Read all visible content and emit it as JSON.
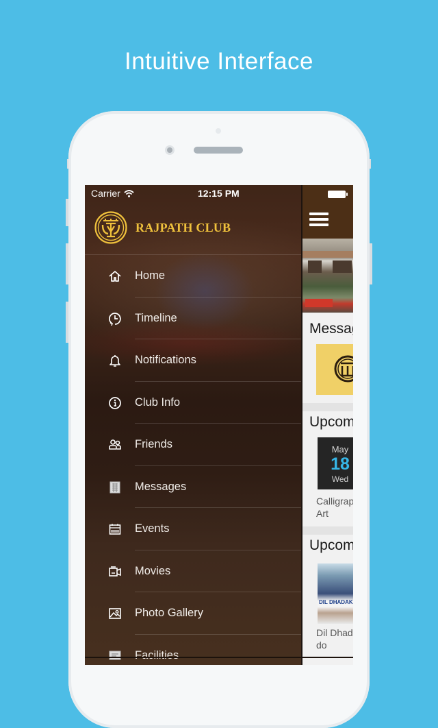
{
  "headline": "Intuitive Interface",
  "status_bar": {
    "carrier": "Carrier",
    "time": "12:15 PM",
    "icons": [
      "wifi-icon",
      "battery-icon"
    ]
  },
  "drawer": {
    "brand_name": "RAJPATH CLUB",
    "logo": "rajpath-club-logo",
    "menu": [
      {
        "label": "Home",
        "icon": "home-icon"
      },
      {
        "label": "Timeline",
        "icon": "clock-history-icon"
      },
      {
        "label": "Notifications",
        "icon": "bell-icon"
      },
      {
        "label": "Club Info",
        "icon": "info-circle-icon"
      },
      {
        "label": "Friends",
        "icon": "friends-icon"
      },
      {
        "label": "Messages",
        "icon": "messages-icon"
      },
      {
        "label": "Events",
        "icon": "calendar-icon"
      },
      {
        "label": "Movies",
        "icon": "video-camera-icon"
      },
      {
        "label": "Photo Gallery",
        "icon": "photo-icon"
      },
      {
        "label": "Facilities",
        "icon": "facilities-icon"
      }
    ]
  },
  "app": {
    "menu_button": "hamburger-menu-icon",
    "sections": [
      {
        "title": "Messages"
      },
      {
        "title": "Upcoming Events",
        "card": {
          "month": "May",
          "day": "18",
          "weekday": "Wed",
          "title_line1": "Calligraphy",
          "title_line2": "Art"
        }
      },
      {
        "title": "Upcoming Movies",
        "card": {
          "poster_text": "DIL DHADAKNE DO",
          "title_line1": "Dil Dhadakne",
          "title_line2": "do"
        }
      }
    ]
  },
  "colors": {
    "background": "#4dbde6",
    "brand_gold": "#efc13c",
    "topbar_brown": "#4c2f16",
    "date_accent": "#36b6e6",
    "message_thumb": "#f0d067"
  }
}
